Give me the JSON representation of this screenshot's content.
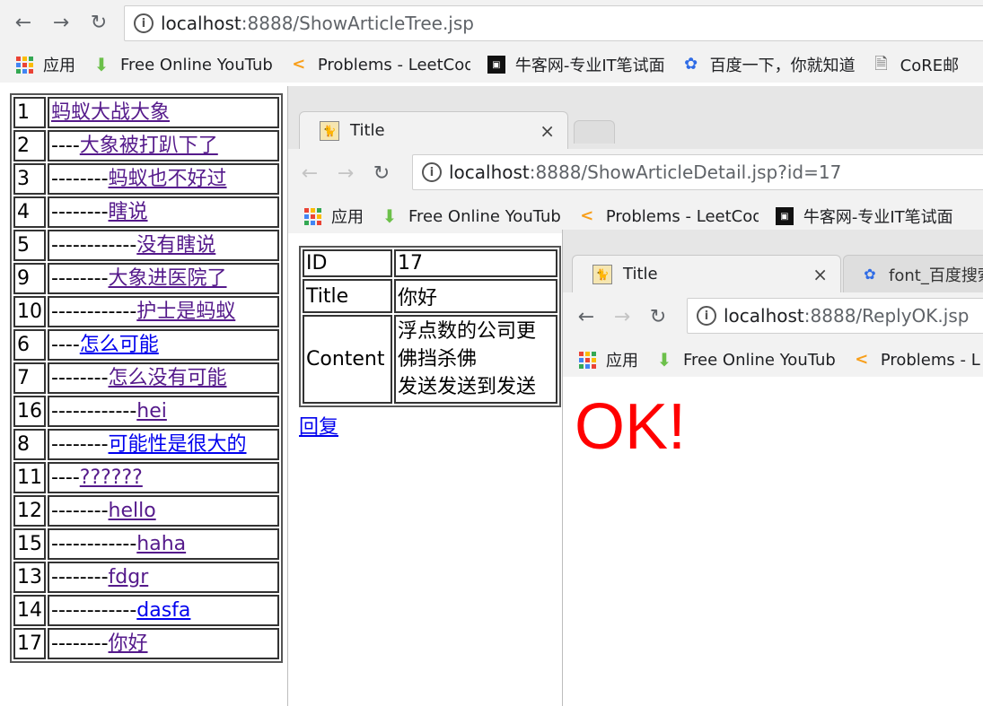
{
  "win1": {
    "omnibox": {
      "host": "localhost",
      "rest": ":8888/ShowArticleTree.jsp"
    },
    "bookmarks": [
      {
        "icon": "apps-grid-icon",
        "label": "应用"
      },
      {
        "icon": "download-arrow-icon",
        "label": "Free Online YouTub"
      },
      {
        "icon": "leetcode-icon",
        "label": "Problems - LeetCod"
      },
      {
        "icon": "nowcoder-icon",
        "label": "牛客网-专业IT笔试面"
      },
      {
        "icon": "baidu-paw-icon",
        "label": "百度一下，你就知道"
      },
      {
        "icon": "document-icon",
        "label": "CoRE邮"
      }
    ],
    "tree": [
      {
        "id": "1",
        "prefix": "",
        "title": "蚂蚁大战大象",
        "visited": true
      },
      {
        "id": "2",
        "prefix": "----",
        "title": "大象被打趴下了",
        "visited": true
      },
      {
        "id": "3",
        "prefix": "--------",
        "title": "蚂蚁也不好过",
        "visited": true
      },
      {
        "id": "4",
        "prefix": "--------",
        "title": "瞎说",
        "visited": true
      },
      {
        "id": "5",
        "prefix": "------------",
        "title": "没有瞎说",
        "visited": true
      },
      {
        "id": "9",
        "prefix": "--------",
        "title": "大象进医院了",
        "visited": true
      },
      {
        "id": "10",
        "prefix": "------------",
        "title": "护士是蚂蚁",
        "visited": true
      },
      {
        "id": "6",
        "prefix": "----",
        "title": "怎么可能",
        "visited": false
      },
      {
        "id": "7",
        "prefix": "--------",
        "title": "怎么没有可能",
        "visited": true
      },
      {
        "id": "16",
        "prefix": "------------",
        "title": "hei",
        "visited": true
      },
      {
        "id": "8",
        "prefix": "--------",
        "title": "可能性是很大的",
        "visited": false
      },
      {
        "id": "11",
        "prefix": "----",
        "title": "??????",
        "visited": true
      },
      {
        "id": "12",
        "prefix": "--------",
        "title": "hello",
        "visited": true
      },
      {
        "id": "15",
        "prefix": "------------",
        "title": "haha",
        "visited": true
      },
      {
        "id": "13",
        "prefix": "--------",
        "title": "fdgr",
        "visited": true
      },
      {
        "id": "14",
        "prefix": "------------",
        "title": "dasfa",
        "visited": false
      },
      {
        "id": "17",
        "prefix": "--------",
        "title": "你好",
        "visited": true
      }
    ]
  },
  "win2": {
    "tab": {
      "title": "Title"
    },
    "omnibox": {
      "host": "localhost",
      "rest": ":8888/ShowArticleDetail.jsp?id=17"
    },
    "bookmarks": [
      {
        "icon": "apps-grid-icon",
        "label": "应用"
      },
      {
        "icon": "download-arrow-icon",
        "label": "Free Online YouTub"
      },
      {
        "icon": "leetcode-icon",
        "label": "Problems - LeetCod"
      },
      {
        "icon": "nowcoder-icon",
        "label": "牛客网-专业IT笔试面"
      }
    ],
    "detail": {
      "id_label": "ID",
      "id_value": "17",
      "title_label": "Title",
      "title_value": "你好",
      "content_label": "Content",
      "content_lines": [
        "浮点数的公司更",
        "佛挡杀佛",
        "发送发送到发送"
      ]
    },
    "reply_label": "回复"
  },
  "win3": {
    "tabs": [
      {
        "title": "Title",
        "active": true
      },
      {
        "title": "font_百度搜索",
        "active": false
      }
    ],
    "omnibox": {
      "host": "localhost",
      "rest": ":8888/ReplyOK.jsp"
    },
    "bookmarks": [
      {
        "icon": "apps-grid-icon",
        "label": "应用"
      },
      {
        "icon": "download-arrow-icon",
        "label": "Free Online YouTub"
      },
      {
        "icon": "leetcode-icon",
        "label": "Problems - L"
      }
    ],
    "message": "OK!",
    "message_color": "#ff0000"
  }
}
